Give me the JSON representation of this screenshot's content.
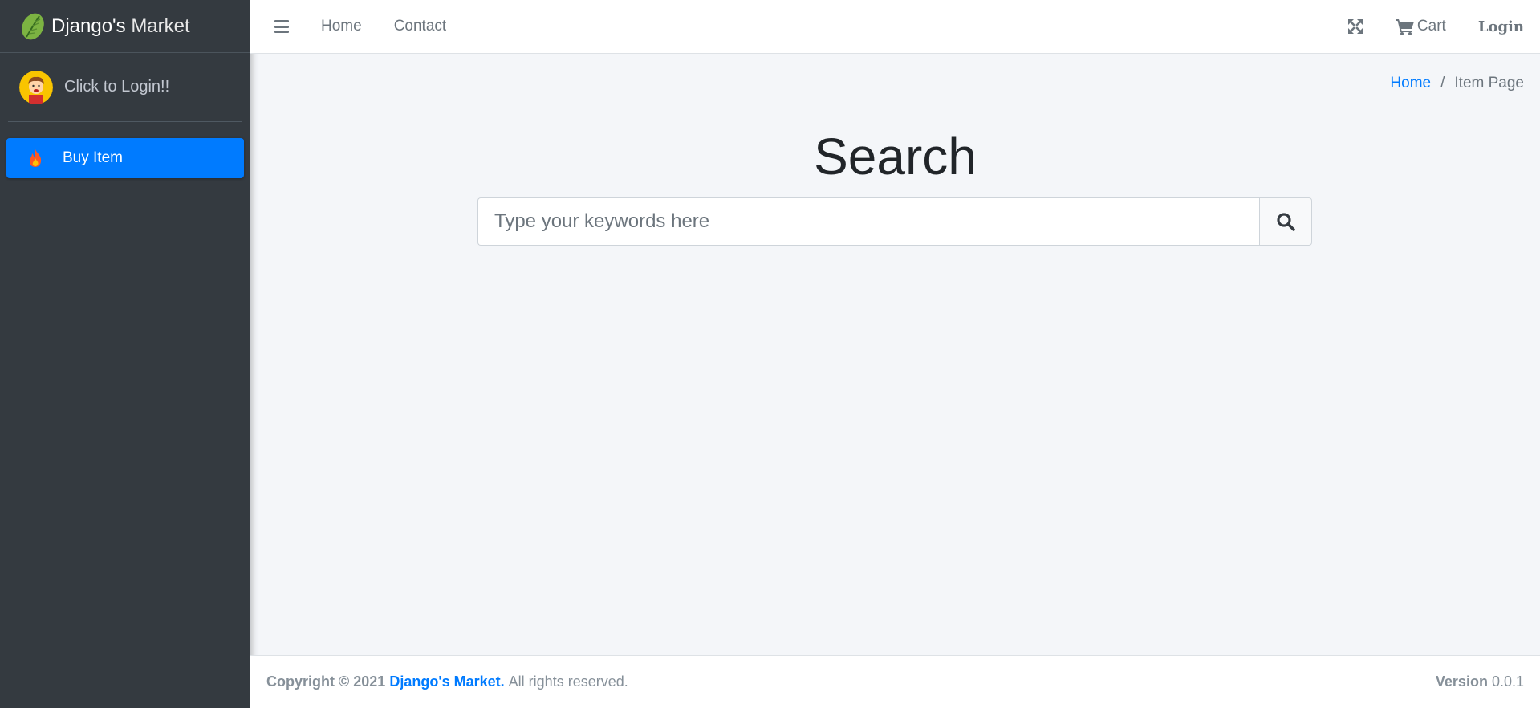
{
  "brand": {
    "bold": "Django's",
    "light": "Market"
  },
  "user_panel": {
    "login_text": "Click to Login!!"
  },
  "sidebar": {
    "items": [
      {
        "label": "Buy Item",
        "icon": "fire-icon"
      }
    ]
  },
  "navbar": {
    "links": [
      {
        "label": "Home"
      },
      {
        "label": "Contact"
      }
    ],
    "cart_label": "Cart",
    "login_label": "Login"
  },
  "breadcrumb": {
    "home": "Home",
    "separator": "/",
    "current": "Item Page"
  },
  "main": {
    "title": "Search",
    "search_placeholder": "Type your keywords here"
  },
  "footer": {
    "copyright_prefix": "Copyright © 2021",
    "brand_link": "Django's Market.",
    "rights": "All rights reserved.",
    "version_label": "Version",
    "version_value": "0.0.1"
  },
  "colors": {
    "sidebar_bg": "#343a40",
    "primary": "#007bff",
    "content_bg": "#f4f6f9"
  }
}
